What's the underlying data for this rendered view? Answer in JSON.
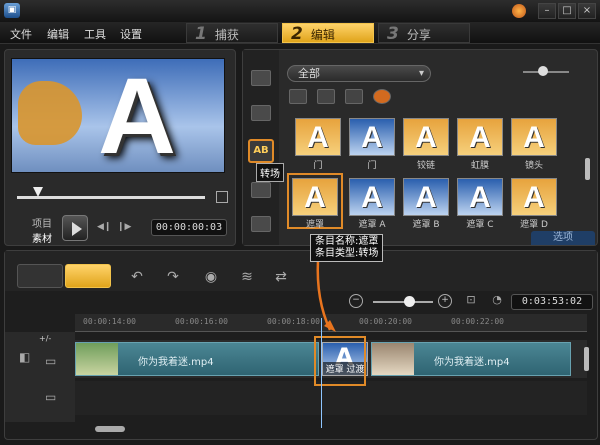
{
  "menu": [
    "文件",
    "编辑",
    "工具",
    "设置"
  ],
  "steps": [
    {
      "num": "1",
      "label": "捕获"
    },
    {
      "num": "2",
      "label": "编辑"
    },
    {
      "num": "3",
      "label": "分享"
    }
  ],
  "preview": {
    "letter": "A",
    "mode_project": "项目",
    "mode_clip": "素材",
    "timecode": "00:00:00:03"
  },
  "library": {
    "category": "全部",
    "tooltip_transition": "转场",
    "thumbs_row1": [
      "门",
      "门",
      "铰链",
      "虹膜",
      "镜头"
    ],
    "thumbs_row2": [
      "遮罩",
      "遮罩 A",
      "遮罩 B",
      "遮罩 C",
      "遮罩 D"
    ],
    "tooltip_effect_line1": "条目名称:遮罩",
    "tooltip_effect_line2": "条目类型:转场",
    "options": "选项"
  },
  "timeline": {
    "duration": "0:03:53:02",
    "ruler": [
      "00:00:14:00",
      "00:00:16:00",
      "00:00:18:00",
      "00:00:20:00",
      "00:00:22:00"
    ],
    "clip1": "你为我着迷.mp4",
    "clip2": "你为我着迷.mp4",
    "transition_label": "遮罩 过渡",
    "plus_minus": "+/-"
  }
}
